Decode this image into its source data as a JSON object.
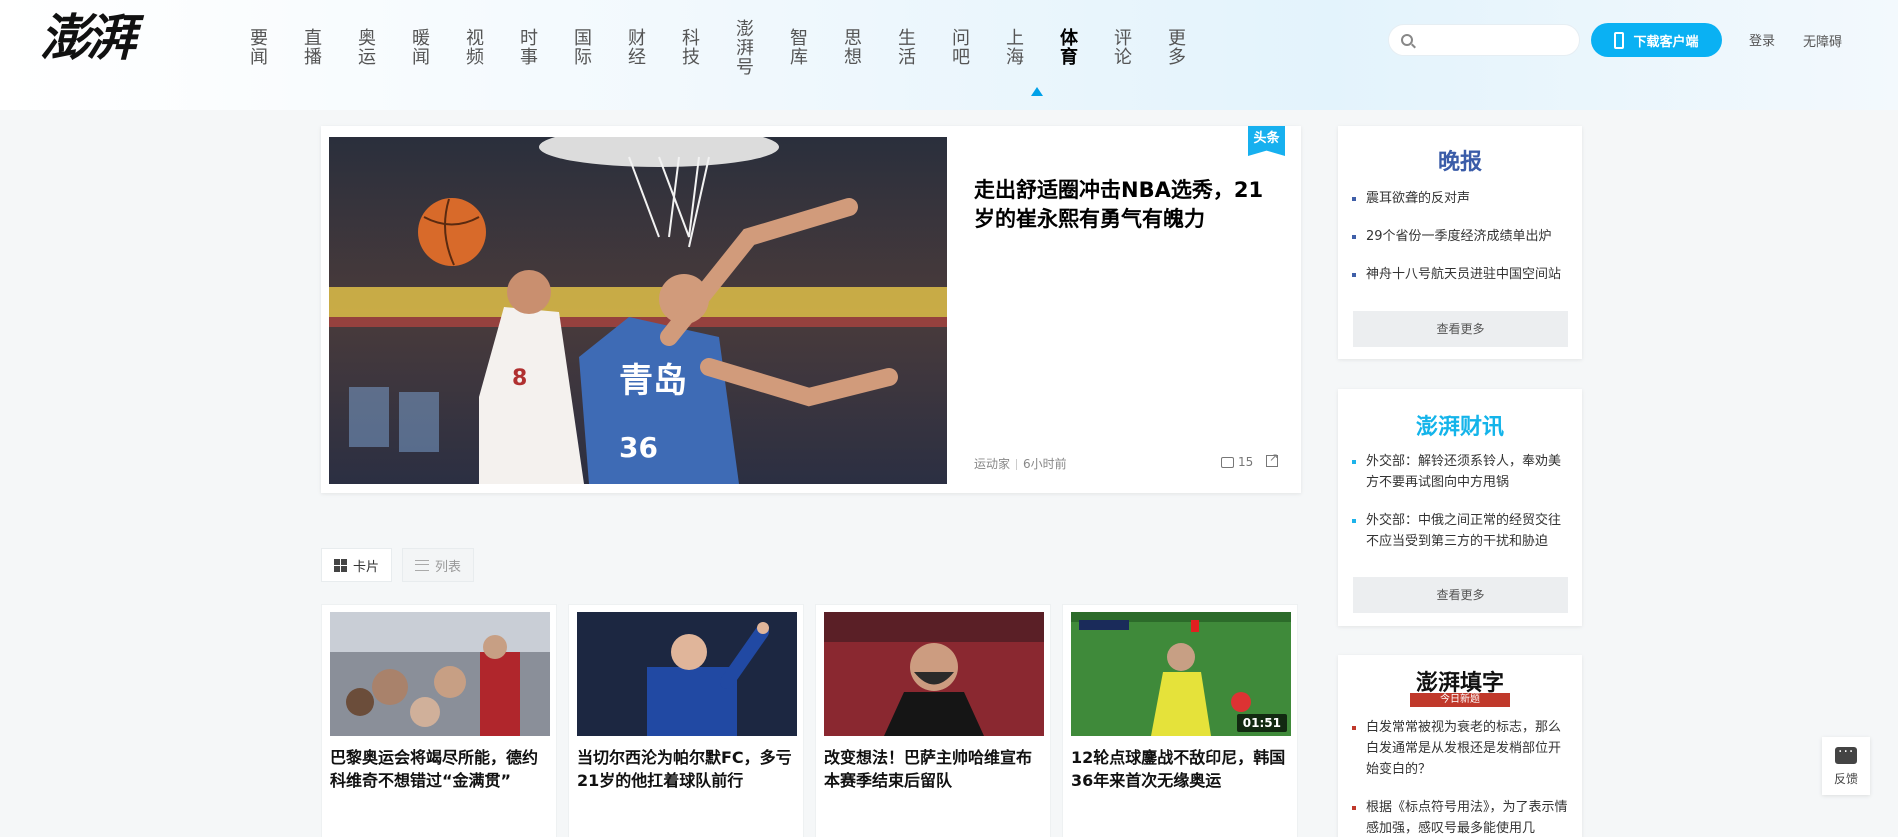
{
  "header": {
    "logo": "澎湃",
    "nav": [
      "要闻",
      "直播",
      "奥运",
      "暖闻",
      "视频",
      "时事",
      "国际",
      "财经",
      "科技",
      "澎湃号",
      "智库",
      "思想",
      "生活",
      "问吧",
      "上海",
      "体育",
      "评论",
      "更多"
    ],
    "active_nav": "体育",
    "search_placeholder": "",
    "download_label": "下载客户端",
    "login_label": "登录",
    "accessibility_label": "无障碍"
  },
  "hero": {
    "badge": "头条",
    "title": "走出舒适圈冲击NBA选秀，21岁的崔永熙有勇气有魄力",
    "source": "运动家",
    "time": "6小时前",
    "comments": "15"
  },
  "view_toggle": {
    "card_label": "卡片",
    "list_label": "列表"
  },
  "cards": [
    {
      "title": "巴黎奥运会将竭尽所能，德约科维奇不想错过“金满贯”",
      "duration": ""
    },
    {
      "title": "当切尔西沦为帕尔默FC，多亏21岁的他扛着球队前行",
      "duration": ""
    },
    {
      "title": "改变想法！巴萨主帅哈维宣布本赛季结束后留队",
      "duration": ""
    },
    {
      "title": "12轮点球鏖战不敌印尼，韩国36年来首次无缘奥运",
      "duration": "01:51"
    }
  ],
  "sidebar": {
    "evening": {
      "logo": "晚报",
      "items": [
        "震耳欲聋的反对声",
        "29个省份一季度经济成绩单出炉",
        "神舟十八号航天员进驻中国空间站"
      ],
      "more_label": "查看更多",
      "bullet_color": "#3f5fa8"
    },
    "finance": {
      "logo": "澎湃财讯",
      "items": [
        "外交部：解铃还须系铃人，奉劝美方不要再试图向中方甩锅",
        "外交部：中俄之间正常的经贸交往不应当受到第三方的干扰和胁迫"
      ],
      "more_label": "查看更多",
      "bullet_color": "#1db3ea"
    },
    "crossword": {
      "logo": "澎湃填字",
      "subtitle": "今日新题",
      "items": [
        "白发常常被视为衰老的标志，那么白发通常是从发根还是发梢部位开始变白的？",
        "根据《标点符号用法》，为了表示情感加强，感叹号最多能使用几"
      ],
      "bullet_color": "#c0392b"
    }
  },
  "feedback_label": "反馈"
}
